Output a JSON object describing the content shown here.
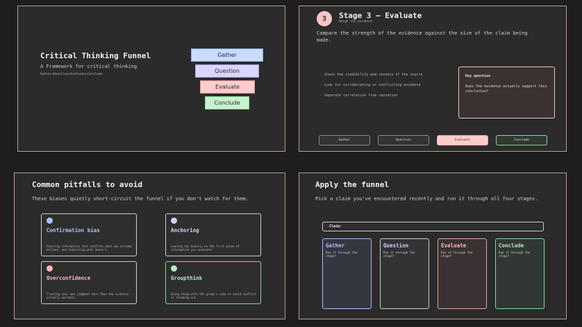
{
  "slide1": {
    "title": "Critical Thinking Funnel",
    "subtitle": "A Framework for critical thinking",
    "flow": "Gather→Question→Evaluate→Conclude",
    "funnel": [
      {
        "label": "Gather",
        "color": "#c9dcff"
      },
      {
        "label": "Question",
        "color": "#d9d6ff"
      },
      {
        "label": "Evaluate",
        "color": "#ffcccc"
      },
      {
        "label": "Conclude",
        "color": "#c5f2cf"
      }
    ]
  },
  "slide2": {
    "number": "3",
    "title": "Stage 3 – Evaluate",
    "subtitle": "Weigh the evidence",
    "intro": "Compare the strength of the evidence against the size of the claim being made.",
    "bullets": [
      "- Check the credibility and recency of the source",
      "- Look for corroborating or conflicting evidence",
      "- Separate correlation from causation"
    ],
    "key_question_label": "Key question",
    "key_question": "Does the evidence actually support this conclusion?",
    "stages": [
      "Gather",
      "Question",
      "Evaluate",
      "Conclude"
    ],
    "active_stage": "Evaluate"
  },
  "slide3": {
    "title": "Common pitfalls to avoid",
    "intro": "These biases quietly short-circuit the funnel if you don't watch for them.",
    "cards": [
      {
        "title": "Confirmation bias",
        "desc": "Favoring information that confirms what you already believe, and dismissing what doesn't.",
        "color": "#a9c4ff"
      },
      {
        "title": "Anchoring",
        "desc": "Leaning too heavily on the first piece of information you encounter.",
        "color": "#d3cfff"
      },
      {
        "title": "Overconfidence",
        "desc": "Trusting your own judgment more than the evidence actually warrants.",
        "color": "#ffb8b8"
      },
      {
        "title": "Groupthink",
        "desc": "Going along with the group's view to avoid conflict or standing out.",
        "color": "#b6ecc2"
      }
    ]
  },
  "slide4": {
    "title": "Apply the funnel",
    "intro": "Pick a claim you've encountered recently and run it through all four stages.",
    "claim_label": "Claim:",
    "stages": [
      {
        "title": "Gather",
        "desc": "Run it through the stage?",
        "color": "#a9c4ff"
      },
      {
        "title": "Question",
        "desc": "Run it through the stage?",
        "color": "#d3cfff"
      },
      {
        "title": "Evaluate",
        "desc": "Run it through the stage?",
        "color": "#ffb8b8"
      },
      {
        "title": "Conclude",
        "desc": "Run it through the stage?",
        "color": "#b6ecc2"
      }
    ]
  }
}
